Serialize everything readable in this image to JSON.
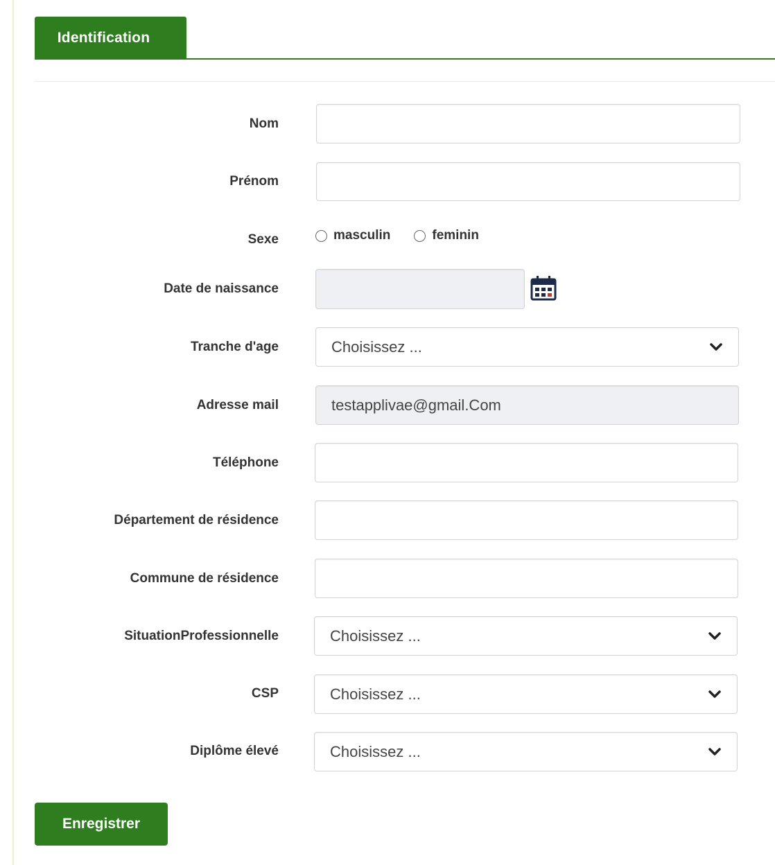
{
  "tab": {
    "label": "Identification"
  },
  "form": {
    "nom": {
      "label": "Nom",
      "value": ""
    },
    "prenom": {
      "label": "Prénom",
      "value": ""
    },
    "sexe": {
      "label": "Sexe",
      "options": [
        "masculin",
        "feminin"
      ]
    },
    "date_naissance": {
      "label": "Date de naissance",
      "value": ""
    },
    "tranche_age": {
      "label": "Tranche d'age",
      "selected": "Choisissez ..."
    },
    "adresse_mail": {
      "label": "Adresse mail",
      "value": "testapplivae@gmail.Com"
    },
    "telephone": {
      "label": "Téléphone",
      "value": ""
    },
    "departement": {
      "label": "Département de résidence",
      "value": ""
    },
    "commune": {
      "label": "Commune de résidence",
      "value": ""
    },
    "situation_pro": {
      "label": "SituationProfessionnelle",
      "selected": "Choisissez ..."
    },
    "csp": {
      "label": "CSP",
      "selected": "Choisissez ..."
    },
    "diplome": {
      "label": "Diplôme élevé",
      "selected": "Choisissez ..."
    }
  },
  "actions": {
    "submit_label": "Enregistrer"
  },
  "colors": {
    "accent": "#2e7d1f"
  },
  "icons": {
    "calendar": "calendar-icon",
    "chevron": "chevron-down-icon"
  }
}
